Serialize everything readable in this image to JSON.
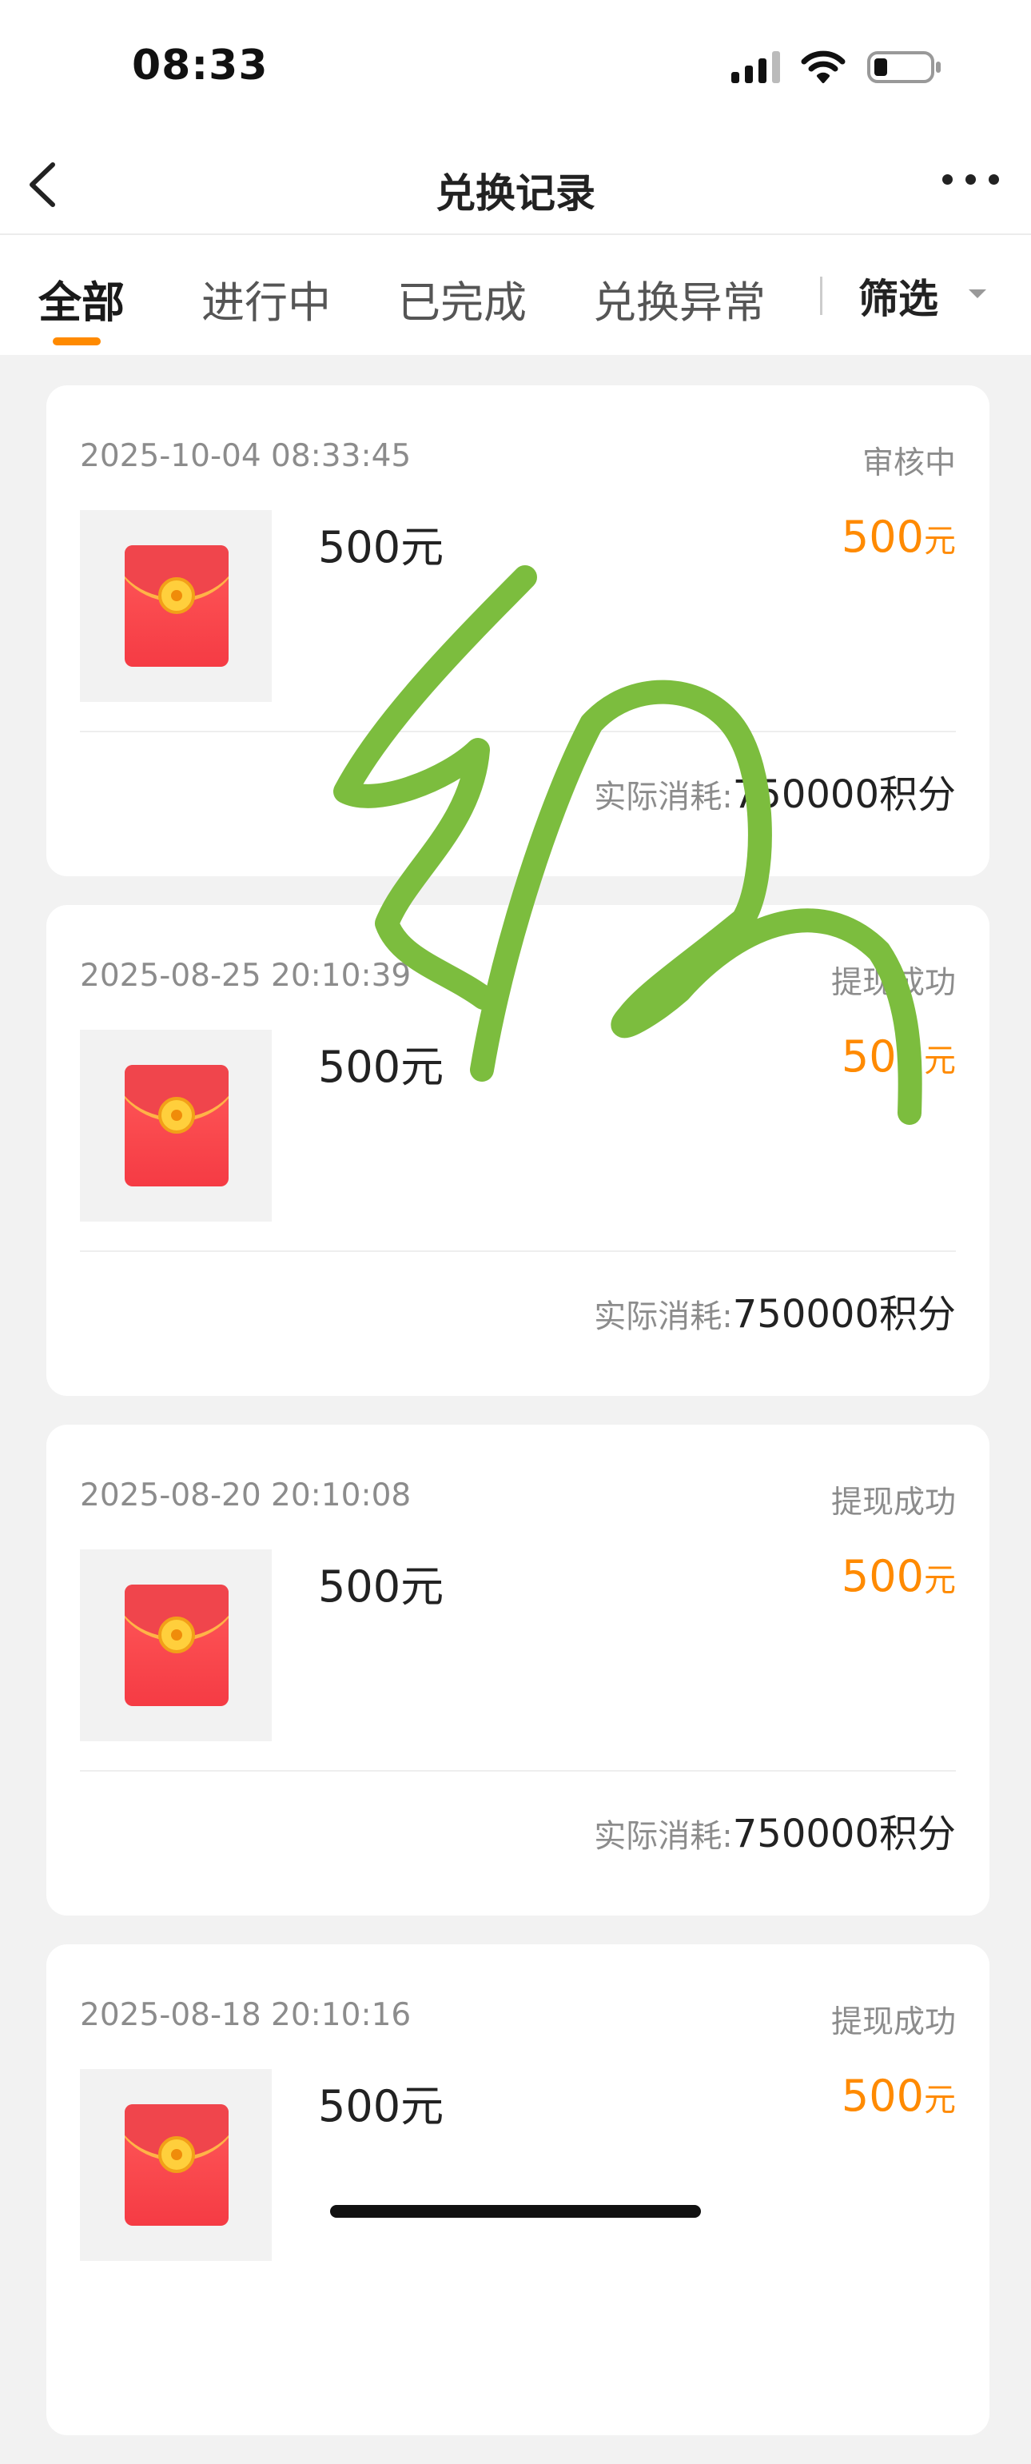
{
  "status_bar": {
    "time": "08:33"
  },
  "nav": {
    "title": "兑换记录"
  },
  "tabs": [
    {
      "label": "全部",
      "active": true
    },
    {
      "label": "进行中",
      "active": false
    },
    {
      "label": "已完成",
      "active": false
    },
    {
      "label": "兑换异常",
      "active": false
    }
  ],
  "filter": {
    "label": "筛选"
  },
  "records": [
    {
      "date": "2025-10-04 08:33:45",
      "status": "审核中",
      "name": "500元",
      "price": "500",
      "price_unit": "元",
      "cost_label": "实际消耗:",
      "cost_value": "750000积分"
    },
    {
      "date": "2025-08-25 20:10:39",
      "status": "提现成功",
      "name": "500元",
      "price": "500",
      "price_unit": "元",
      "cost_label": "实际消耗:",
      "cost_value": "750000积分"
    },
    {
      "date": "2025-08-20 20:10:08",
      "status": "提现成功",
      "name": "500元",
      "price": "500",
      "price_unit": "元",
      "cost_label": "实际消耗:",
      "cost_value": "750000积分"
    },
    {
      "date": "2025-08-18 20:10:16",
      "status": "提现成功",
      "name": "500元",
      "price": "500",
      "price_unit": "元",
      "cost_label": "",
      "cost_value": ""
    }
  ],
  "colors": {
    "accent": "#ff8a00",
    "scribble": "#7cbd3e",
    "background": "#f2f2f2"
  }
}
